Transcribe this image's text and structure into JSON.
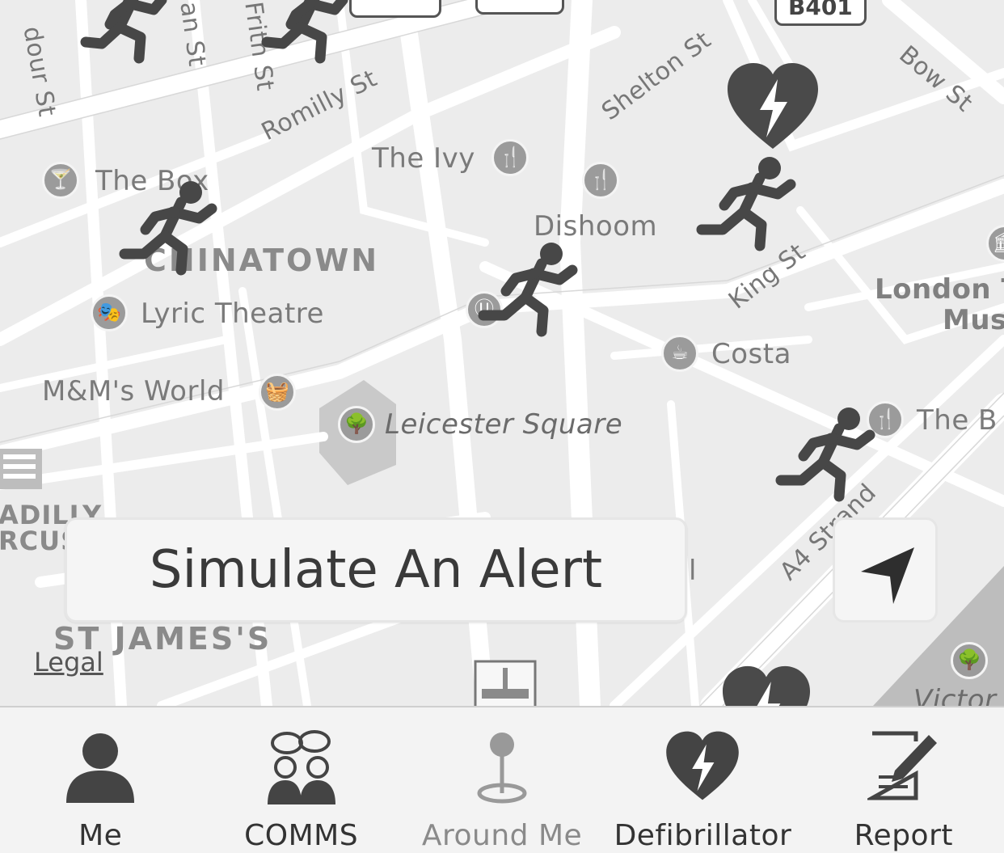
{
  "map": {
    "labels": {
      "dour_st": "dour St",
      "dean_st": "an St",
      "frith_st": "Frith St",
      "romilly_st": "Romilly St",
      "shelton_st": "Shelton St",
      "bow_st": "Bow St",
      "king_st": "King St",
      "strand": "A4 Strand",
      "chinatown": "CHINATOWN",
      "st_jamess": "ST JAMES'S",
      "piccadilly": "ADILLY",
      "circus": "RCUS",
      "the_box": "The Box",
      "the_ivy": "The Ivy",
      "dishoom": "Dishoom",
      "lyric_theatre": "Lyric Theatre",
      "mms_world": "M&M's World",
      "leicester_square": "Leicester Square",
      "costa": "Costa",
      "london_t": "London T",
      "mus": "Mus",
      "the_b": "The B",
      "victoria": "Victor",
      "road_badge": "B401",
      "partial_l": "l"
    }
  },
  "buttons": {
    "simulate_alert": "Simulate An Alert",
    "legal": "Legal"
  },
  "tabs": [
    {
      "label": "Me",
      "icon": "person-icon"
    },
    {
      "label": "COMMS",
      "icon": "chat-people-icon"
    },
    {
      "label": "Around Me",
      "icon": "map-pin-icon",
      "active": true
    },
    {
      "label": "Defibrillator",
      "icon": "defibrillator-heart-icon"
    },
    {
      "label": "Report",
      "icon": "report-edit-icon"
    }
  ],
  "colors": {
    "map_bg": "#ececec",
    "road": "#ffffff",
    "marker": "#4a4a4a",
    "tab_active": "#8a8a8a"
  }
}
